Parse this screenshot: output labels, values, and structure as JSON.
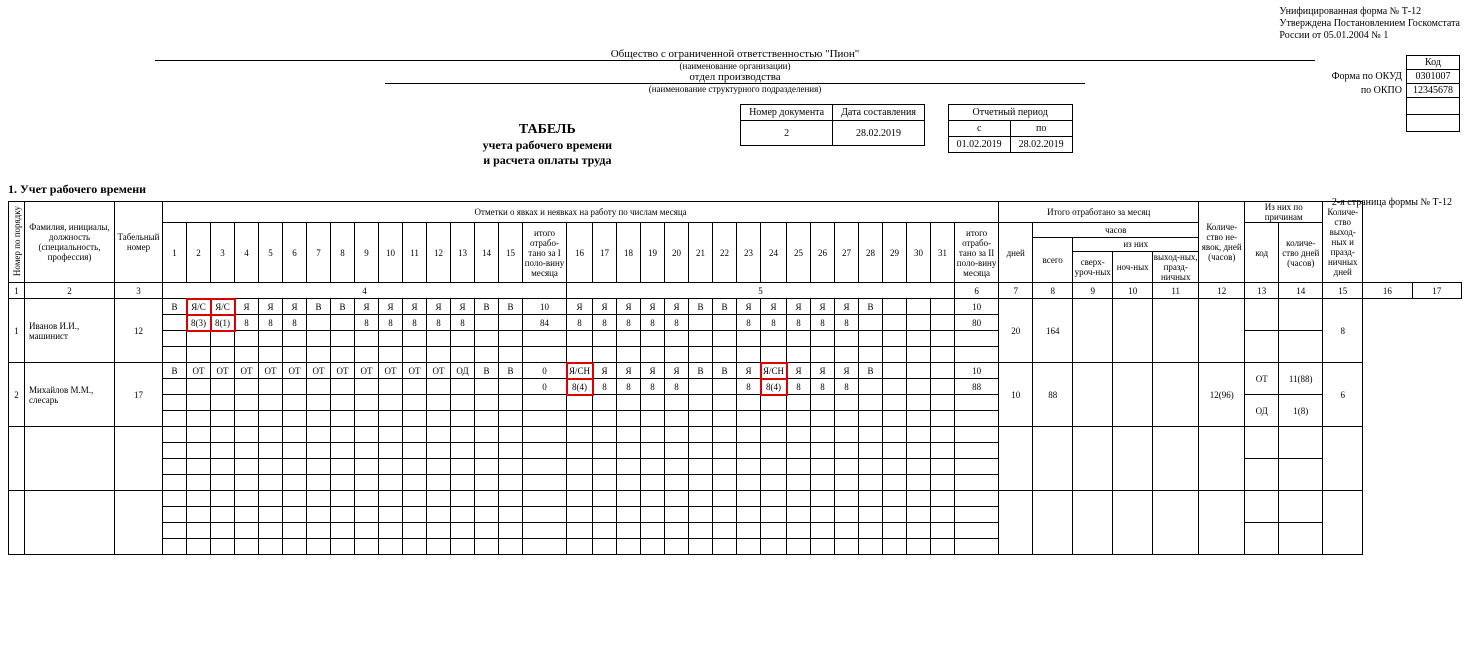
{
  "form": {
    "line1": "Унифицированная форма № Т-12",
    "line2": "Утверждена Постановлением Госкомстата",
    "line3": "России от 05.01.2004 № 1"
  },
  "org": {
    "name": "Общество с ограниченной ответственностью \"Пион\"",
    "name_note": "(наименование организации)",
    "dept": "отдел производства",
    "dept_note": "(наименование структурного подразделения)"
  },
  "codes": {
    "kod_label": "Код",
    "okud_label": "Форма по ОКУД",
    "okud": "0301007",
    "okpo_label": "по ОКПО",
    "okpo": "12345678"
  },
  "title": {
    "t1": "ТАБЕЛЬ",
    "t2": "учета рабочего времени",
    "t3": "и расчета оплаты  труда"
  },
  "docmeta": {
    "num_label": "Номер документа",
    "date_label": "Дата составления",
    "num": "2",
    "date": "28.02.2019",
    "period_label": "Отчетный период",
    "from_label": "с",
    "to_label": "по",
    "from": "01.02.2019",
    "to": "28.02.2019"
  },
  "section1": "1. Учет рабочего времени",
  "page2": "2-я страница формы № Т-12",
  "headers": {
    "col1": "Номер по порядку",
    "col2": "Фамилия, инициалы, должность (специальность, профессия)",
    "col3": "Табельный номер",
    "attendance": "Отметки о явках и неявках на работу по числам месяца",
    "half1": "итого отрабо-тано за I поло-вину месяца",
    "half2": "итого отрабо-тано за II поло-вину месяца",
    "month_total": "Итого отработано за месяц",
    "days": "дней",
    "hours": "часов",
    "total": "всего",
    "ofthem": "из них",
    "over": "сверх-уроч-ных",
    "night": "ноч-ных",
    "weekend": "выход-ных, празд-ничных",
    "absences": "Количе-ство не-явок, дней (часов)",
    "reasons": "Из них по причинам",
    "code": "код",
    "qty": "количе-ство дней (часов)",
    "holidays": "Количе-ство выход-ных и празд-ничных дней"
  },
  "colnums": [
    "1",
    "2",
    "3",
    "4",
    "5",
    "6",
    "7",
    "8",
    "9",
    "10",
    "11",
    "12",
    "13",
    "14",
    "15",
    "16",
    "17"
  ],
  "days1": [
    "1",
    "2",
    "3",
    "4",
    "5",
    "6",
    "7",
    "8",
    "9",
    "10",
    "11",
    "12",
    "13",
    "14",
    "15"
  ],
  "days2": [
    "16",
    "17",
    "18",
    "19",
    "20",
    "21",
    "22",
    "23",
    "24",
    "25",
    "26",
    "27",
    "28",
    "29",
    "30",
    "31"
  ],
  "rows": [
    {
      "n": "1",
      "name": "Иванов И.И., машинист",
      "tab": "12",
      "r1a": [
        "В",
        "Я/С",
        "Я/С",
        "Я",
        "Я",
        "Я",
        "В",
        "В",
        "Я",
        "Я",
        "Я",
        "Я",
        "Я",
        "В",
        "В"
      ],
      "r1a_red": [
        false,
        true,
        true,
        false,
        false,
        false,
        false,
        false,
        false,
        false,
        false,
        false,
        false,
        false,
        false
      ],
      "half1a": "10",
      "r1b": [
        "",
        "8(3)",
        "8(1)",
        "8",
        "8",
        "8",
        "",
        "",
        "8",
        "8",
        "8",
        "8",
        "8",
        "",
        ""
      ],
      "r1b_red": [
        false,
        true,
        true,
        false,
        false,
        false,
        false,
        false,
        false,
        false,
        false,
        false,
        false,
        false,
        false
      ],
      "half1b": "84",
      "r2a": [
        "Я",
        "Я",
        "Я",
        "Я",
        "Я",
        "В",
        "В",
        "Я",
        "Я",
        "Я",
        "Я",
        "Я",
        "В",
        "",
        "",
        ""
      ],
      "r2a_red": [
        false,
        false,
        false,
        false,
        false,
        false,
        false,
        false,
        false,
        false,
        false,
        false,
        false,
        false,
        false,
        false
      ],
      "half2a": "10",
      "r2b": [
        "8",
        "8",
        "8",
        "8",
        "8",
        "",
        "",
        "8",
        "8",
        "8",
        "8",
        "8",
        "",
        "",
        "",
        ""
      ],
      "r2b_red": [
        false,
        false,
        false,
        false,
        false,
        false,
        false,
        false,
        false,
        false,
        false,
        false,
        false,
        false,
        false,
        false
      ],
      "half2b": "80",
      "days": "20",
      "hours": "164",
      "over": "",
      "night": "",
      "wknd": "",
      "abs": "",
      "codeA": "",
      "qtyA": "",
      "codeB": "",
      "qtyB": "",
      "hol": "8"
    },
    {
      "n": "2",
      "name": "Михайлов М.М., слесарь",
      "tab": "17",
      "r1a": [
        "В",
        "ОТ",
        "ОТ",
        "ОТ",
        "ОТ",
        "ОТ",
        "ОТ",
        "ОТ",
        "ОТ",
        "ОТ",
        "ОТ",
        "ОТ",
        "ОД",
        "В",
        "В"
      ],
      "r1a_red": [
        false,
        false,
        false,
        false,
        false,
        false,
        false,
        false,
        false,
        false,
        false,
        false,
        false,
        false,
        false
      ],
      "half1a": "0",
      "r1b": [
        "",
        "",
        "",
        "",
        "",
        "",
        "",
        "",
        "",
        "",
        "",
        "",
        "",
        "",
        ""
      ],
      "r1b_red": [
        false,
        false,
        false,
        false,
        false,
        false,
        false,
        false,
        false,
        false,
        false,
        false,
        false,
        false,
        false
      ],
      "half1b": "0",
      "r2a": [
        "Я/СН",
        "Я",
        "Я",
        "Я",
        "Я",
        "В",
        "В",
        "Я",
        "Я/СН",
        "Я",
        "Я",
        "Я",
        "В",
        "",
        "",
        ""
      ],
      "r2a_red": [
        true,
        false,
        false,
        false,
        false,
        false,
        false,
        false,
        true,
        false,
        false,
        false,
        false,
        false,
        false,
        false
      ],
      "half2a": "10",
      "r2b": [
        "8(4)",
        "8",
        "8",
        "8",
        "8",
        "",
        "",
        "8",
        "8(4)",
        "8",
        "8",
        "8",
        "",
        "",
        "",
        ""
      ],
      "r2b_red": [
        true,
        false,
        false,
        false,
        false,
        false,
        false,
        false,
        true,
        false,
        false,
        false,
        false,
        false,
        false,
        false
      ],
      "half2b": "88",
      "days": "10",
      "hours": "88",
      "over": "",
      "night": "",
      "wknd": "",
      "abs": "12(96)",
      "codeA": "ОТ",
      "qtyA": "11(88)",
      "codeB": "ОД",
      "qtyB": "1(8)",
      "hol": "6"
    }
  ]
}
